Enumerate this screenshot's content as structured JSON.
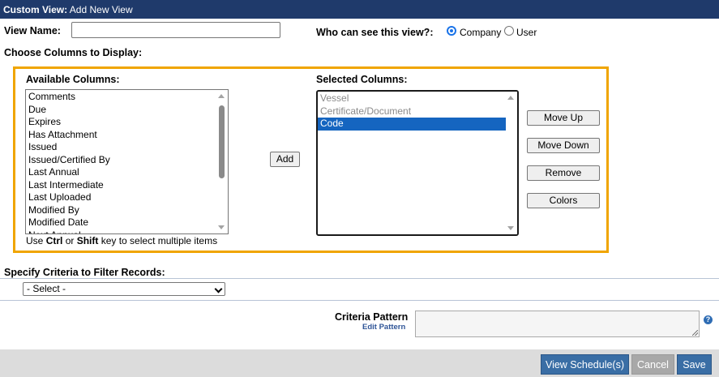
{
  "header": {
    "title_bold": "Custom View:",
    "title_rest": " Add New View"
  },
  "view_name": {
    "label": "View Name:",
    "value": ""
  },
  "visibility": {
    "label": "Who can see this view?:",
    "options": [
      {
        "label": "Company",
        "selected": true
      },
      {
        "label": "User",
        "selected": false
      }
    ]
  },
  "columns": {
    "heading": "Choose Columns to Display:",
    "available_label": "Available Columns:",
    "available": [
      "Comments",
      "Due",
      "Expires",
      "Has Attachment",
      "Issued",
      "Issued/Certified By",
      "Last Annual",
      "Last Intermediate",
      "Last Uploaded",
      "Modified By",
      "Modified Date",
      "Next Annual"
    ],
    "selected_label": "Selected Columns:",
    "selected": [
      {
        "label": "Vessel",
        "state": "disabled"
      },
      {
        "label": "Certificate/Document",
        "state": "disabled"
      },
      {
        "label": "Code",
        "state": "highlighted"
      }
    ],
    "add_label": "Add",
    "hint_pre": "Use ",
    "hint_key1": "Ctrl",
    "hint_mid": " or ",
    "hint_key2": "Shift",
    "hint_post": " key to select multiple items",
    "side_buttons": [
      "Move Up",
      "Move Down",
      "Remove",
      "Colors"
    ]
  },
  "criteria": {
    "heading": "Specify Criteria to Filter Records:",
    "select_value": "- Select -",
    "pattern_label": "Criteria Pattern",
    "edit_pattern": "Edit Pattern",
    "pattern_value": ""
  },
  "footer": {
    "view_schedule": "View Schedule(s)",
    "cancel": "Cancel",
    "save": "Save"
  },
  "colors": {
    "header_bg": "#1f3a6b",
    "highlight": "#1565c0",
    "accent_border": "#f0a500",
    "primary_button": "#3a6ea5",
    "disabled_button": "#a8a8a8"
  }
}
